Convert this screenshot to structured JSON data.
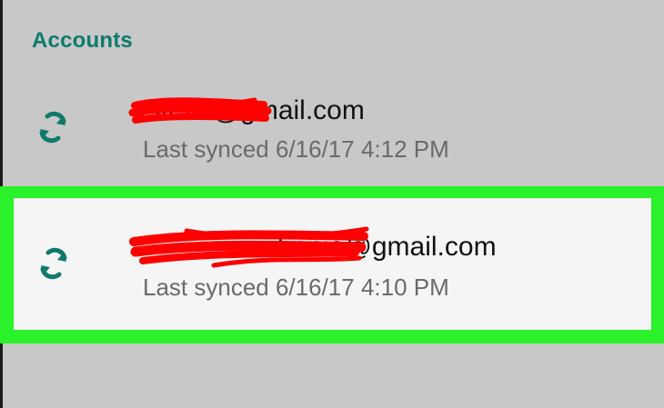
{
  "header": {
    "title": "Accounts"
  },
  "accounts": [
    {
      "email_visible": "vsteve@gmail.com",
      "last_synced": "Last synced 6/16/17 4:12 PM",
      "icon": "sync-icon"
    },
    {
      "email_visible": "hanie@gmail.com",
      "last_synced": "Last synced 6/16/17 4:10 PM",
      "icon": "sync-icon",
      "highlighted": true
    }
  ],
  "colors": {
    "accent": "#0f7a6b",
    "highlight": "#2bf22b",
    "redaction": "#ff0000",
    "background": "#c8c8c8",
    "card": "#f5f5f5"
  }
}
